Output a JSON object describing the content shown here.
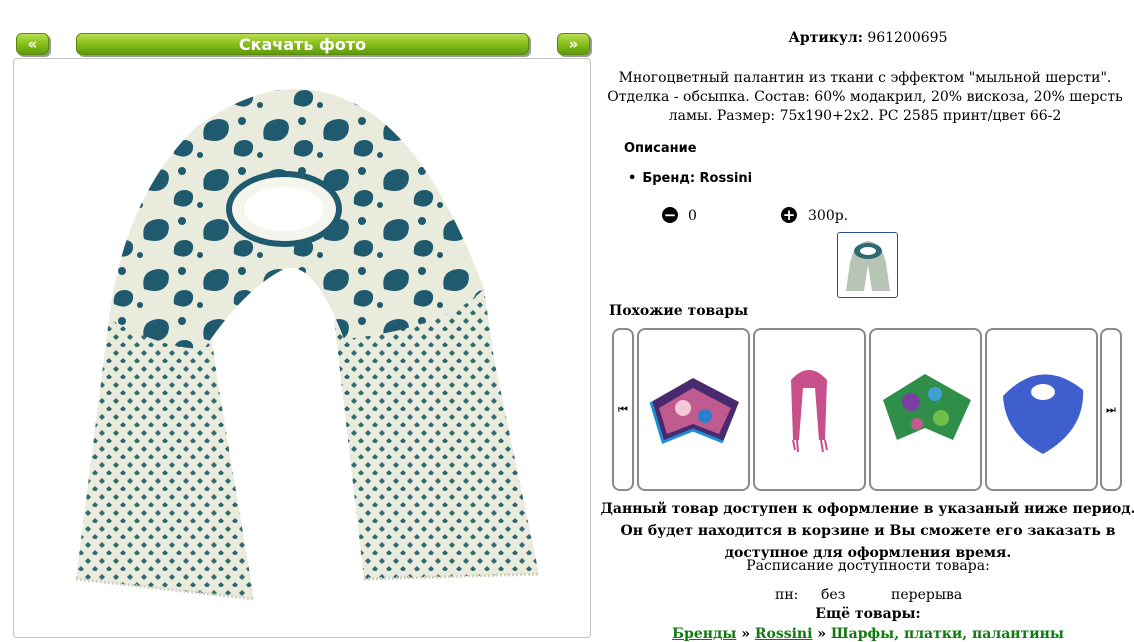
{
  "nav": {
    "prev_label": "«",
    "download_label": "Скачать фото",
    "next_label": "»"
  },
  "product": {
    "article_label": "Артикул:",
    "article_value": "961200695",
    "description": "Многоцветный палантин из ткани с эффектом \"мыльной шерсти\". Отделка - обсыпка. Состав: 60% модакрил, 20% вискоза, 20% шерсть ламы. Размер: 75x190+2x2. PC 2585 принт/цвет 66-2",
    "description_heading": "Описание",
    "brand_line": "Бренд: Rossini",
    "quantity": "0",
    "price": "300р."
  },
  "similar": {
    "title": "Похожие товары",
    "prev_icon": "skip-back-icon",
    "next_icon": "skip-forward-icon",
    "items": [
      {
        "name": "purple-floral-scarf",
        "color": "#5a2e78"
      },
      {
        "name": "pink-stole",
        "color": "#c8508a"
      },
      {
        "name": "green-floral-scarf",
        "color": "#2f8f4a"
      },
      {
        "name": "blue-scarf",
        "color": "#3f5fcf"
      }
    ]
  },
  "availability": {
    "note": "Данный товар доступен к оформление в указаный ниже период. Он будет находится в корзине и Вы сможете его заказать в доступное для оформления время.",
    "schedule_title": "Расписание доступности товара:",
    "day": "пн:",
    "from": "без",
    "to": "перерыва"
  },
  "more": {
    "title": "Ещё товары:",
    "crumbs": [
      "Бренды",
      "Rossini",
      "Шарфы, платки, палантины"
    ],
    "separator": "»"
  },
  "colors": {
    "accent_green": "#8cc21f",
    "paisley_blue": "#1f5a6e",
    "scarf_cream": "#e9ebdc",
    "link_green": "#0f7a0f"
  }
}
